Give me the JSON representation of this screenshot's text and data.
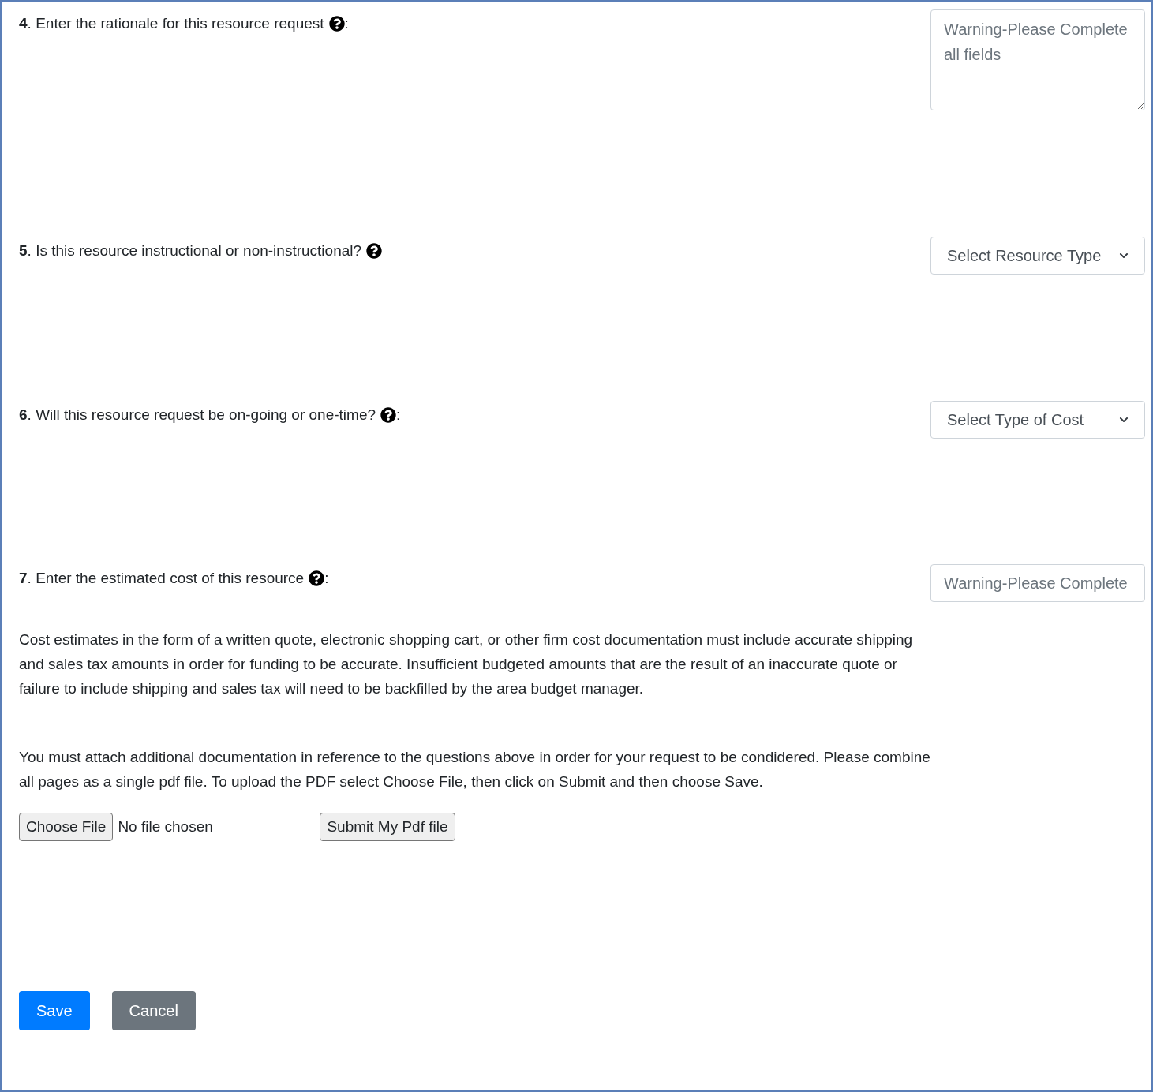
{
  "questions": [
    {
      "label": "**4**. Enter the rationale for this resource request",
      "suffix": ":",
      "field": {
        "kind": "textarea",
        "placeholder": "Warning-Please Complete all fields"
      }
    },
    {
      "label": "**5**. Is this resource instructional or non-instructional?",
      "field": {
        "kind": "select",
        "value": "Select Resource Type"
      }
    },
    {
      "label": "**6**. Will this resource request be on-going or one-time?",
      "suffix": ":",
      "field": {
        "kind": "select",
        "value": "Select Type of Cost"
      }
    },
    {
      "label": "**7**. Enter the estimated cost of this resource",
      "suffix": ":",
      "field": {
        "kind": "input",
        "placeholder": "Warning-Please Complete"
      }
    }
  ],
  "paragraphs": [
    "Cost estimates in the form of a written quote, electronic shopping cart, or other firm cost documentation must include accurate shipping and sales tax amounts in order for funding to be accurate. Insufficient budgeted amounts that are the result of an inaccurate quote or failure to include shipping and sales tax will need to be backfilled by the area budget manager.",
    "You must attach additional documentation in reference to the questions above in order for your request to be condidered. Please combine all pages as a single pdf file. To upload the PDF select Choose File, then click on Submit and then choose Save."
  ],
  "file_upload": {
    "button": "Choose File",
    "status": "No file chosen",
    "submit": "Submit My Pdf file"
  },
  "actions": [
    {
      "label": "Save",
      "kind": "primary"
    },
    {
      "label": "Cancel",
      "kind": "secondary"
    }
  ]
}
